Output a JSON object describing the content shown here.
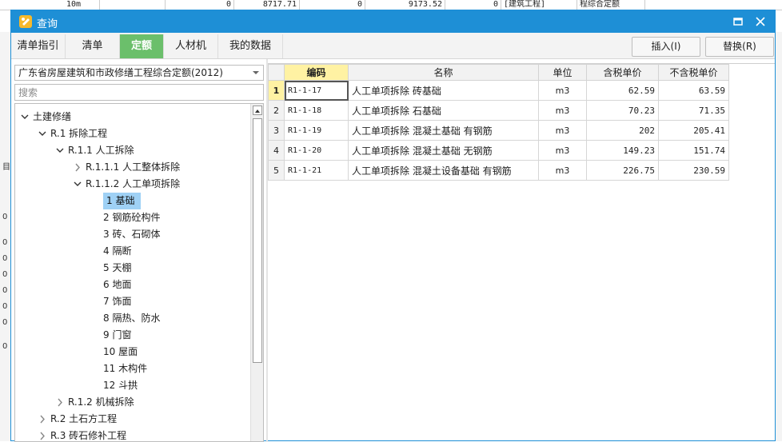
{
  "background": {
    "row_cells": [
      "10m",
      "0",
      "8717.71",
      "0",
      "9173.52",
      "0",
      "[建筑工程]",
      "程综合定额"
    ],
    "left_numbers": [
      "0",
      "0",
      "0",
      "0",
      "0",
      "0",
      "0",
      "0"
    ],
    "left_glyph": "目"
  },
  "dialog": {
    "title": "查询",
    "accent_color": "#1e8fd6"
  },
  "tabs": [
    {
      "label": "清单指引"
    },
    {
      "label": "清单"
    },
    {
      "label": "定额"
    },
    {
      "label": "人材机"
    },
    {
      "label": "我的数据"
    }
  ],
  "active_tab": "定额",
  "toolbar": {
    "insert_label": "插入(I)",
    "replace_label": "替换(R)"
  },
  "library": {
    "selected": "广东省房屋建筑和市政修缮工程综合定额(2012)"
  },
  "search": {
    "placeholder": "搜索",
    "value": ""
  },
  "tree": [
    {
      "label": "土建修缮",
      "level": 0,
      "state": "expanded"
    },
    {
      "label": "R.1 拆除工程",
      "level": 1,
      "state": "expanded"
    },
    {
      "label": "R.1.1 人工拆除",
      "level": 2,
      "state": "expanded"
    },
    {
      "label": "R.1.1.1 人工整体拆除",
      "level": 3,
      "state": "collapsed"
    },
    {
      "label": "R.1.1.2 人工单项拆除",
      "level": 3,
      "state": "expanded"
    },
    {
      "label": "1 基础",
      "level": 4,
      "state": "leaf",
      "selected": true
    },
    {
      "label": "2 钢筋砼构件",
      "level": 4,
      "state": "leaf"
    },
    {
      "label": "3 砖、石砌体",
      "level": 4,
      "state": "leaf"
    },
    {
      "label": "4 隔断",
      "level": 4,
      "state": "leaf"
    },
    {
      "label": "5 天棚",
      "level": 4,
      "state": "leaf"
    },
    {
      "label": "6 地面",
      "level": 4,
      "state": "leaf"
    },
    {
      "label": "7 饰面",
      "level": 4,
      "state": "leaf"
    },
    {
      "label": "8 隔热、防水",
      "level": 4,
      "state": "leaf"
    },
    {
      "label": "9 门窗",
      "level": 4,
      "state": "leaf"
    },
    {
      "label": "10 屋面",
      "level": 4,
      "state": "leaf"
    },
    {
      "label": "11 木构件",
      "level": 4,
      "state": "leaf"
    },
    {
      "label": "12 斗拱",
      "level": 4,
      "state": "leaf"
    },
    {
      "label": "R.1.2 机械拆除",
      "level": 2,
      "state": "collapsed"
    },
    {
      "label": "R.2 土石方工程",
      "level": 1,
      "state": "collapsed"
    },
    {
      "label": "R.3 砖石修补工程",
      "level": 1,
      "state": "collapsed"
    }
  ],
  "table": {
    "columns": [
      "编码",
      "名称",
      "单位",
      "含税单价",
      "不含税单价"
    ],
    "rows": [
      {
        "index": "1",
        "code": "R1-1-17",
        "name": "人工单项拆除 砖基础",
        "unit": "m3",
        "price_tax": "62.59",
        "price_notax": "63.59"
      },
      {
        "index": "2",
        "code": "R1-1-18",
        "name": "人工单项拆除 石基础",
        "unit": "m3",
        "price_tax": "70.23",
        "price_notax": "71.35"
      },
      {
        "index": "3",
        "code": "R1-1-19",
        "name": "人工单项拆除 混凝土基础 有钢筋",
        "unit": "m3",
        "price_tax": "202",
        "price_notax": "205.41"
      },
      {
        "index": "4",
        "code": "R1-1-20",
        "name": "人工单项拆除 混凝土基础 无钢筋",
        "unit": "m3",
        "price_tax": "149.23",
        "price_notax": "151.74"
      },
      {
        "index": "5",
        "code": "R1-1-21",
        "name": "人工单项拆除 混凝土设备基础 有钢筋",
        "unit": "m3",
        "price_tax": "226.75",
        "price_notax": "230.59"
      }
    ]
  }
}
